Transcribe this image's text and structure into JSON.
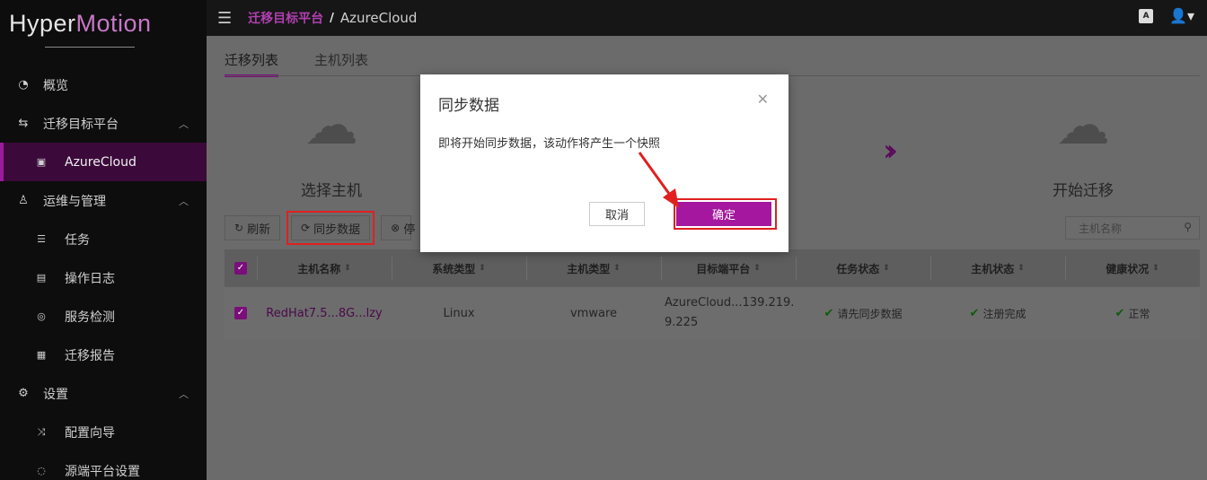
{
  "app": {
    "logo_part1": "Hyper",
    "logo_part2": "Motion"
  },
  "sidebar": {
    "items": [
      {
        "label": "概览",
        "icon": "dashboard-icon"
      },
      {
        "label": "迁移目标平台",
        "icon": "swap-icon",
        "expanded": true
      },
      {
        "label": "AzureCloud",
        "icon": "folder-icon",
        "active": true
      },
      {
        "label": "运维与管理",
        "icon": "user-icon",
        "expanded": true
      },
      {
        "label": "任务",
        "icon": "list-icon"
      },
      {
        "label": "操作日志",
        "icon": "log-icon"
      },
      {
        "label": "服务检测",
        "icon": "monitor-icon"
      },
      {
        "label": "迁移报告",
        "icon": "report-icon"
      },
      {
        "label": "设置",
        "icon": "gear-icon",
        "expanded": true
      },
      {
        "label": "配置向导",
        "icon": "shuffle-icon"
      },
      {
        "label": "源端平台设置",
        "icon": "settings-icon"
      }
    ]
  },
  "topbar": {
    "breadcrumb_root": "迁移目标平台",
    "breadcrumb_sep": "/",
    "breadcrumb_current": "AzureCloud"
  },
  "tabs": [
    "迁移列表",
    "主机列表"
  ],
  "steps": {
    "select_host": "选择主机",
    "start_migration": "开始迁移"
  },
  "toolbar": {
    "refresh": "刷新",
    "sync": "同步数据",
    "stop_partial": "停"
  },
  "search": {
    "placeholder": "主机名称"
  },
  "table": {
    "headers": [
      "主机名称",
      "系统类型",
      "主机类型",
      "目标端平台",
      "任务状态",
      "主机状态",
      "健康状况"
    ],
    "rows": [
      {
        "host_name": "RedHat7.5...8G...lzy",
        "os_type": "Linux",
        "host_type": "vmware",
        "target_line1": "AzureCloud...139.219.",
        "target_line2": "9.225",
        "task_status": "请先同步数据",
        "host_status": "注册完成",
        "health": "正常"
      }
    ]
  },
  "dialog": {
    "title": "同步数据",
    "message": "即将开始同步数据，该动作将产生一个快照",
    "cancel": "取消",
    "confirm": "确定"
  },
  "colors": {
    "accent": "#a5179f",
    "highlight": "#e02020",
    "ok": "#0c5c0c"
  }
}
